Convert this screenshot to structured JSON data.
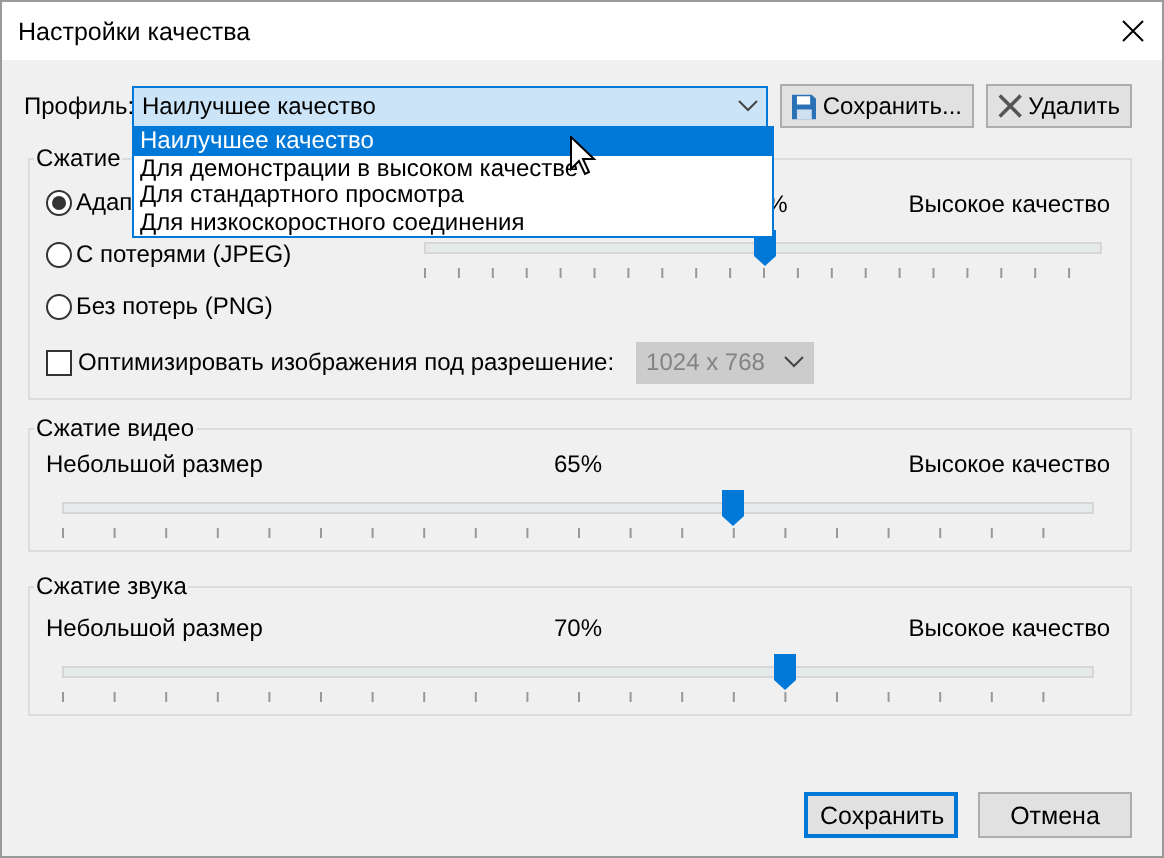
{
  "window": {
    "title": "Настройки качества"
  },
  "profile": {
    "label": "Профиль:",
    "value": "Наилучшее качество",
    "expanded": true,
    "options": [
      {
        "label": "Наилучшее качество",
        "selected": true
      },
      {
        "label": "Для демонстрации в высоком качестве",
        "selected": false
      },
      {
        "label": "Для стандартного просмотра",
        "selected": false
      },
      {
        "label": "Для низкоскоростного соединения",
        "selected": false
      }
    ]
  },
  "profile_buttons": [
    {
      "kind": "save",
      "label": "Сохранить..."
    },
    {
      "kind": "delete",
      "label": "Удалить"
    }
  ],
  "image_compression": {
    "title": "Сжатие",
    "modes": [
      {
        "label": "Адап",
        "selected": true
      },
      {
        "label": "С потерями (JPEG)",
        "selected": false
      },
      {
        "label": "Без потерь (PNG)",
        "selected": false
      }
    ],
    "slider": {
      "value_label": "%",
      "right_label": "Высокое качество",
      "level": 0.5
    },
    "optimize": {
      "label": "Оптимизировать изображения под разрешение:",
      "checked": false
    },
    "resolution": {
      "value": "1024 x 768",
      "disabled": true
    }
  },
  "video_compression": {
    "title": "Сжатие видео",
    "left_label": "Небольшой размер",
    "value_label": "65%",
    "right_label": "Высокое качество",
    "level": 0.65
  },
  "audio_compression": {
    "title": "Сжатие звука",
    "left_label": "Небольшой размер",
    "value_label": "70%",
    "right_label": "Высокое качество",
    "level": 0.7
  },
  "buttons": [
    {
      "label": "Сохранить",
      "default": true
    },
    {
      "label": "Отмена",
      "default": false
    }
  ]
}
